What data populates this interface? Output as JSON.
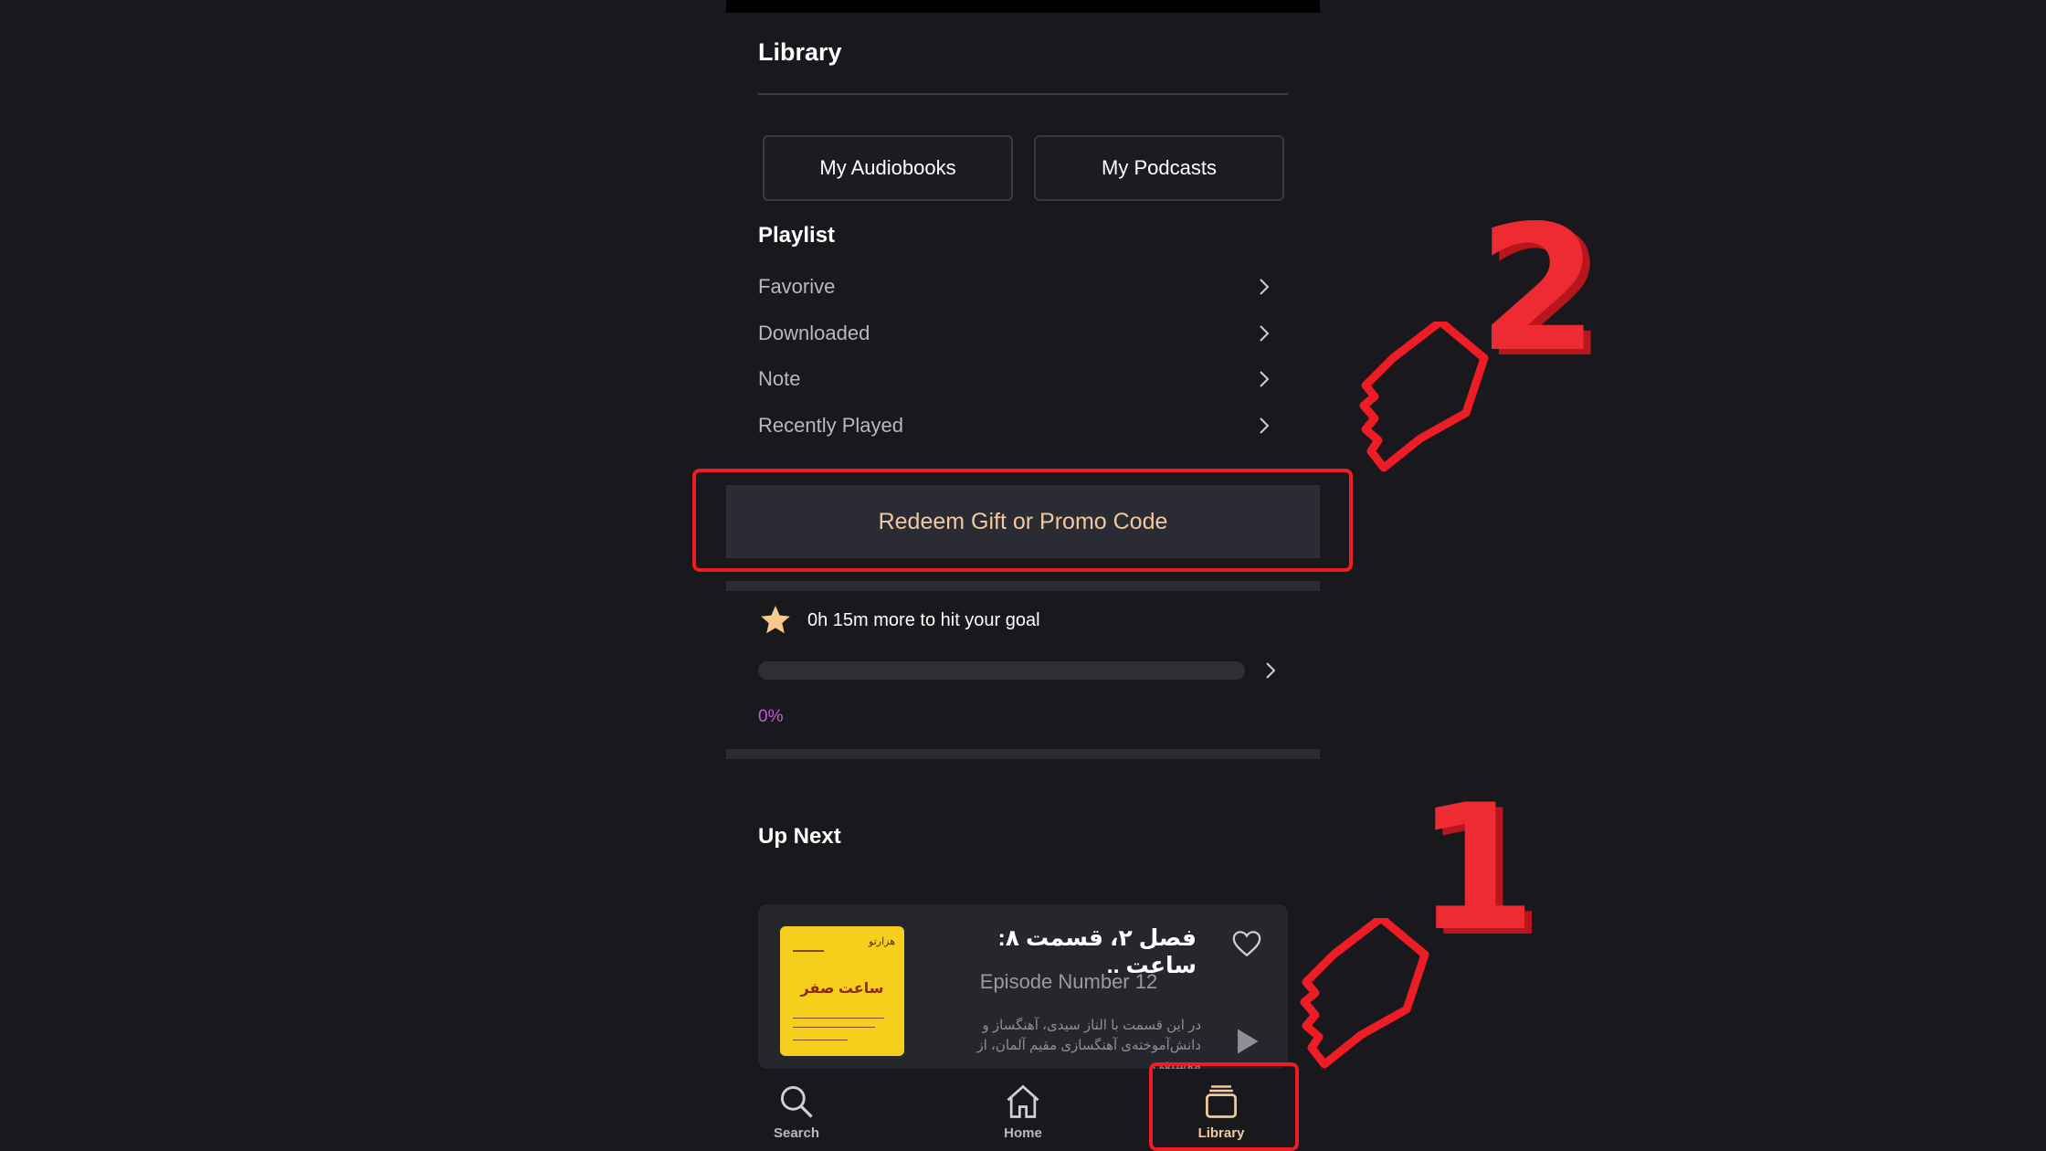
{
  "header": {
    "title": "Library"
  },
  "tabs": [
    {
      "label": "My Audiobooks"
    },
    {
      "label": "My Podcasts"
    }
  ],
  "playlist": {
    "heading": "Playlist",
    "items": [
      {
        "label": "Favorive"
      },
      {
        "label": "Downloaded"
      },
      {
        "label": "Note"
      },
      {
        "label": "Recently Played"
      }
    ]
  },
  "redeem": {
    "label": "Redeem Gift or Promo Code"
  },
  "goal": {
    "text": "0h 15m more to hit your goal",
    "percent_label": "0%",
    "progress": 0
  },
  "up_next": {
    "heading": "Up Next",
    "episode": {
      "title": "فصل ۲، قسمت ۸: ساعت ..",
      "number": "Episode Number 12",
      "description": "در این قسمت با الناز سیدی، آهنگساز و دانش‌آموخته‌ی آهنگسازی مقیم آلمان، از موسیقی",
      "cover_top": "هزارتو",
      "cover_title": "ساعت صفر"
    }
  },
  "bottom_nav": [
    {
      "label": "Search",
      "icon": "search-icon"
    },
    {
      "label": "Home",
      "icon": "home-icon"
    },
    {
      "label": "Library",
      "icon": "library-icon",
      "active": true
    }
  ],
  "annotations": {
    "step_1": "1",
    "step_2": "2"
  },
  "colors": {
    "accent": "#f0c9a0",
    "progress": "#c45bd1",
    "highlight": "#ee1c24",
    "background": "#18181d"
  }
}
